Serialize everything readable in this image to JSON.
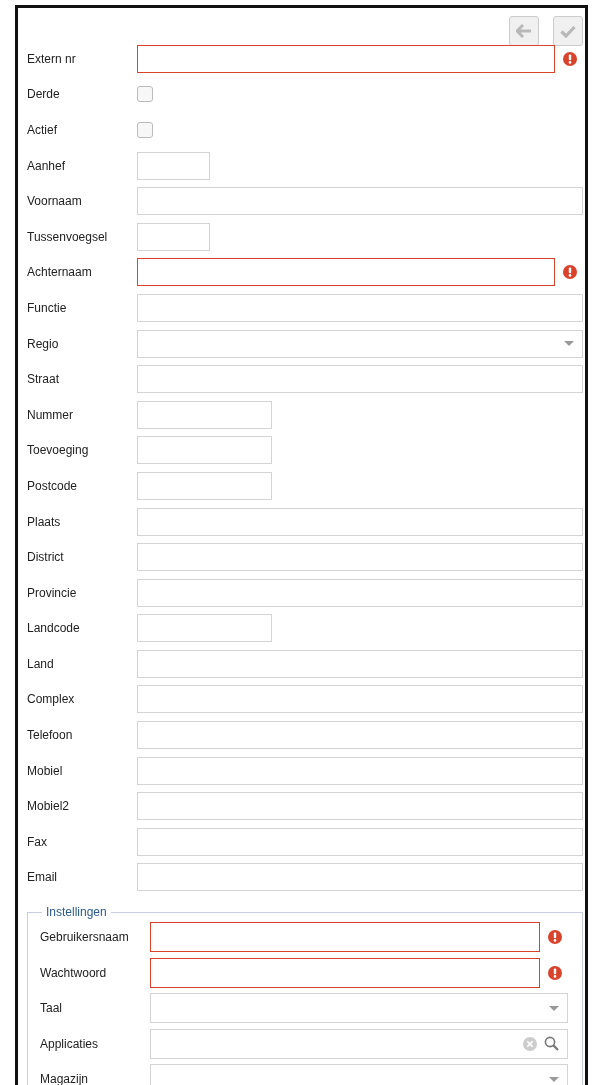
{
  "toolbar": {
    "buttons": [
      {
        "kind": "back",
        "disabled": true
      },
      {
        "kind": "save",
        "disabled": true
      }
    ]
  },
  "fields": [
    {
      "label": "Extern nr",
      "kind": "wide",
      "error": true
    },
    {
      "label": "Derde",
      "kind": "checkbox",
      "checked": false,
      "error": false
    },
    {
      "label": "Actief",
      "kind": "checkbox",
      "checked": false,
      "error": false
    },
    {
      "label": "Aanhef",
      "kind": "short",
      "error": false
    },
    {
      "label": "Voornaam",
      "kind": "wide",
      "error": false
    },
    {
      "label": "Tussenvoegsel",
      "kind": "short",
      "error": false
    },
    {
      "label": "Achternaam",
      "kind": "wide",
      "error": true
    },
    {
      "label": "Functie",
      "kind": "wide",
      "error": false
    },
    {
      "label": "Regio",
      "kind": "select",
      "error": false
    },
    {
      "label": "Straat",
      "kind": "wide",
      "error": false
    },
    {
      "label": "Nummer",
      "kind": "medium",
      "error": false
    },
    {
      "label": "Toevoeging",
      "kind": "medium",
      "error": false
    },
    {
      "label": "Postcode",
      "kind": "medium",
      "error": false
    },
    {
      "label": "Plaats",
      "kind": "wide",
      "error": false
    },
    {
      "label": "District",
      "kind": "wide",
      "error": false
    },
    {
      "label": "Provincie",
      "kind": "wide",
      "error": false
    },
    {
      "label": "Landcode",
      "kind": "medium",
      "error": false
    },
    {
      "label": "Land",
      "kind": "wide",
      "error": false
    },
    {
      "label": "Complex",
      "kind": "wide",
      "error": false
    },
    {
      "label": "Telefoon",
      "kind": "wide",
      "error": false
    },
    {
      "label": "Mobiel",
      "kind": "wide",
      "error": false
    },
    {
      "label": "Mobiel2",
      "kind": "wide",
      "error": false
    },
    {
      "label": "Fax",
      "kind": "wide",
      "error": false
    },
    {
      "label": "Email",
      "kind": "wide",
      "error": false
    }
  ],
  "settings": {
    "legend": "Instellingen",
    "fields": [
      {
        "label": "Gebruikersnaam",
        "kind": "wide",
        "error": true
      },
      {
        "label": "Wachtwoord",
        "kind": "wide",
        "error": true
      },
      {
        "label": "Taal",
        "kind": "select",
        "error": false
      },
      {
        "label": "Applicaties",
        "kind": "lookup",
        "error": false
      },
      {
        "label": "Magazijn",
        "kind": "select",
        "error": false
      }
    ]
  }
}
